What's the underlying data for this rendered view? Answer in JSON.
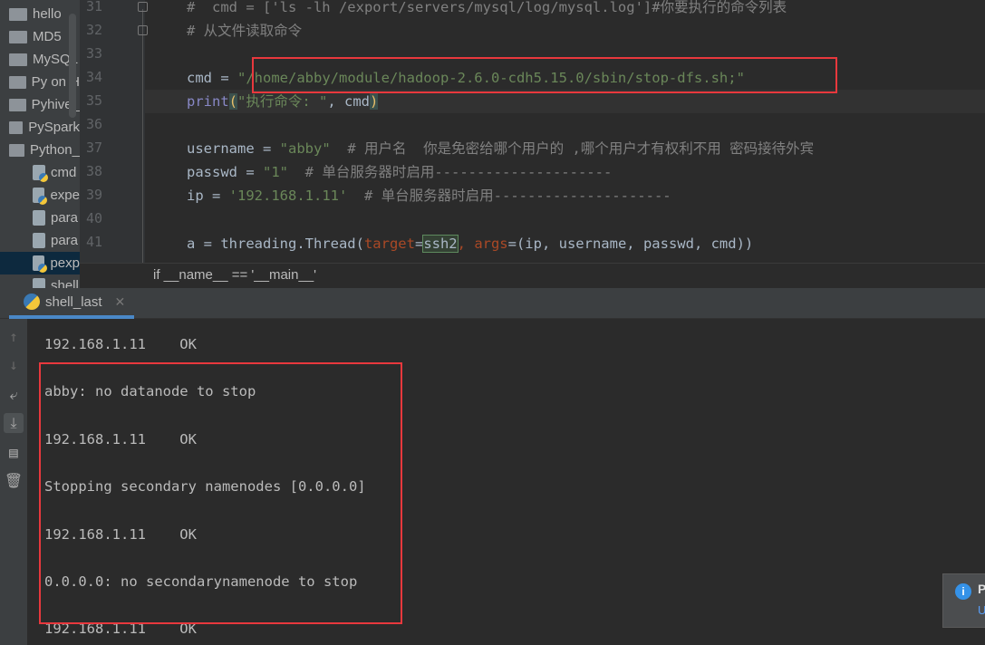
{
  "sidebar": {
    "items": [
      {
        "label": "hello",
        "type": "folder"
      },
      {
        "label": "MD5",
        "type": "folder"
      },
      {
        "label": "MySQL",
        "type": "folder"
      },
      {
        "label": "Py on H",
        "type": "folder"
      },
      {
        "label": "Pyhive_",
        "type": "folder"
      },
      {
        "label": "PySpark",
        "type": "folder"
      },
      {
        "label": "Python_",
        "type": "folder"
      },
      {
        "label": "cmd",
        "type": "py"
      },
      {
        "label": "expe",
        "type": "py"
      },
      {
        "label": "para",
        "type": "text"
      },
      {
        "label": "para",
        "type": "text"
      },
      {
        "label": "pexp",
        "type": "py",
        "selected": true
      },
      {
        "label": "shell",
        "type": "text"
      }
    ]
  },
  "editor": {
    "line_numbers": [
      "31",
      "32",
      "33",
      "34",
      "35",
      "36",
      "37",
      "38",
      "39",
      "40",
      "41"
    ],
    "lines": {
      "l31": "#  cmd = ['ls -lh /export/servers/mysql/log/mysql.log']#你要执行的命令列表",
      "l32": "# 从文件读取命令",
      "l34a": "cmd = ",
      "l34b": "\"/home/abby/module/hadoop-2.6.0-cdh5.15.0/sbin/stop-dfs.sh;\"",
      "l35a": "print",
      "l35b": "(",
      "l35c": "\"执行命令: \"",
      "l35d": ", cmd",
      "l35e": ")",
      "l37a": "username = ",
      "l37b": "\"abby\"",
      "l37c": "  # 用户名  你是免密给哪个用户的 ,哪个用户才有权利不用 密码接待外宾",
      "l38a": "passwd = ",
      "l38b": "\"1\"",
      "l38c": "  # 单台服务器时启用---------------------",
      "l39a": "ip = ",
      "l39b": "'192.168.1.11'",
      "l39c": "  # 单台服务器时启用---------------------",
      "l41a": "a = threading.Thread(",
      "l41b": "target",
      "l41c": "=",
      "l41d": "ssh2",
      "l41e": ", ",
      "l41f": "args",
      "l41g": "=(ip, username, passwd, cmd))"
    },
    "breadcrumb": "if __name__ == '__main__'"
  },
  "run_panel": {
    "tab_label": "shell_last",
    "output": [
      "192.168.1.11    OK",
      "abby: no datanode to stop",
      "192.168.1.11    OK",
      "Stopping secondary namenodes [0.0.0.0]",
      "192.168.1.11    OK",
      "0.0.0.0: no secondarynamenode to stop",
      "192.168.1.11    OK"
    ]
  },
  "notification": {
    "title": "P",
    "link": "U"
  },
  "colors": {
    "highlight_box": "#e8383d",
    "string": "#6a8759",
    "keyword_arg": "#aa4926",
    "comment": "#808080"
  }
}
